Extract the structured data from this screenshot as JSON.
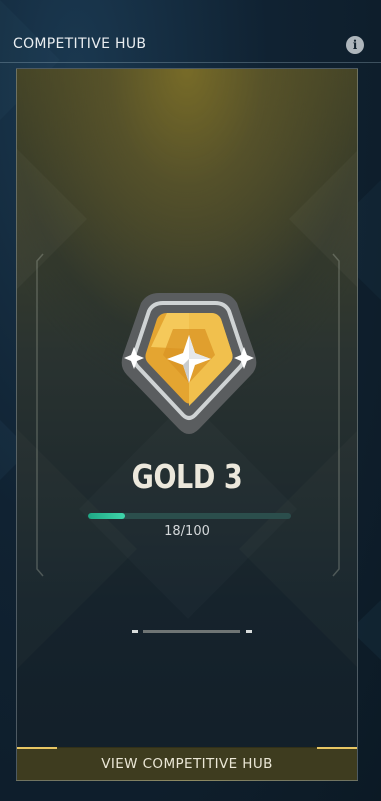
{
  "header": {
    "title": "COMPETITIVE HUB",
    "info_icon": "info-icon"
  },
  "rank": {
    "name": "GOLD 3",
    "progress_text": "18/100",
    "progress_fraction": 0.18,
    "emblem_icon": "gold-rank-emblem-icon"
  },
  "pager": {
    "pages": 3,
    "active_index": 1
  },
  "footer": {
    "button_label": "VIEW COMPETITIVE HUB"
  },
  "colors": {
    "accent_gold": "#e8c663",
    "progress_fill": "#3fd6ab",
    "progress_track": "#2b4e4c",
    "button_bg": "#3e3c1f"
  }
}
